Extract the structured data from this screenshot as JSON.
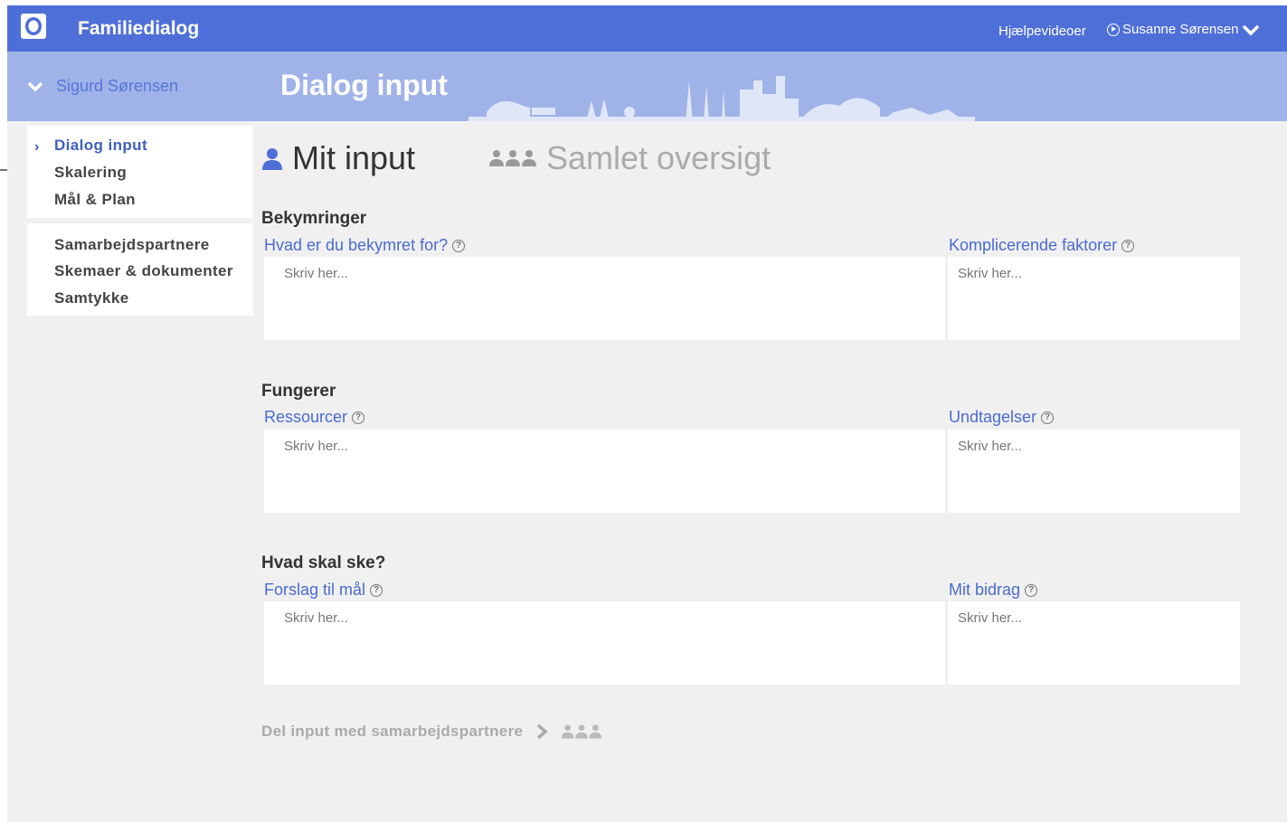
{
  "topbar": {
    "app_title": "Familiedialog",
    "help_link": "Hjælpevideoer",
    "user_name": "Susanne Sørensen"
  },
  "header": {
    "child_name": "Sigurd Sørensen",
    "page_title": "Dialog input"
  },
  "nav": {
    "primary": [
      {
        "label": "Dialog input",
        "active": true
      },
      {
        "label": "Skalering",
        "active": false
      },
      {
        "label": "Mål & Plan",
        "active": false
      }
    ],
    "secondary": [
      {
        "label": "Samarbejdspartnere"
      },
      {
        "label": "Skemaer & dokumenter"
      },
      {
        "label": "Samtykke"
      }
    ]
  },
  "tabs": {
    "mine": "Mit input",
    "all": "Samlet oversigt"
  },
  "sections": [
    {
      "title": "Bekymringer",
      "left_label": "Hvad er du bekymret for?",
      "right_label": "Komplicerende faktorer",
      "left_placeholder": "Skriv her...",
      "right_placeholder": "Skriv her..."
    },
    {
      "title": "Fungerer",
      "left_label": "Ressourcer",
      "right_label": "Undtagelser",
      "left_placeholder": "Skriv her...",
      "right_placeholder": "Skriv her..."
    },
    {
      "title": "Hvad skal ske?",
      "left_label": "Forslag til mål",
      "right_label": "Mit bidrag",
      "left_placeholder": "Skriv her...",
      "right_placeholder": "Skriv her..."
    }
  ],
  "share": {
    "label": "Del input med samarbejdspartnere"
  },
  "colors": {
    "topbar": "#4f6fd8",
    "band": "#9fb3e8",
    "link": "#4a6bd0",
    "background": "#f0f0f0"
  }
}
